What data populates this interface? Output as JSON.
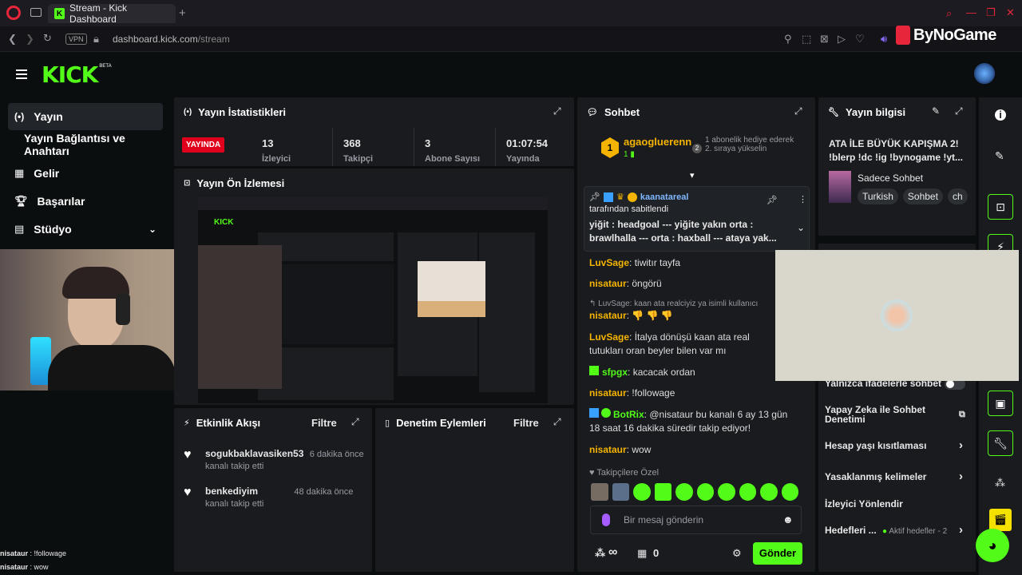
{
  "browser": {
    "tab_title": "Stream - Kick Dashboard",
    "new_tab": "+",
    "url_host": "dashboard.kick.com",
    "url_path": "/stream",
    "vpn_label": "VPN",
    "watermark": "ByNoGame"
  },
  "app": {
    "logo": "KICK",
    "logo_badge": "BETA"
  },
  "sidebar": {
    "items": [
      {
        "label": "Yayın",
        "icon": "broadcast-icon"
      },
      {
        "label": "Yayın Bağlantısı ve Anahtarı"
      },
      {
        "label": "Gelir",
        "icon": "chart-icon"
      },
      {
        "label": "Başarılar",
        "icon": "trophy-icon"
      },
      {
        "label": "Stüdyo",
        "icon": "studio-icon"
      }
    ]
  },
  "stats": {
    "title": "Yayın İstatistikleri",
    "live_badge": "YAYINDA",
    "items": [
      {
        "value": "13",
        "label": "İzleyici"
      },
      {
        "value": "368",
        "label": "Takipçi"
      },
      {
        "value": "3",
        "label": "Abone Sayısı"
      },
      {
        "value": "01:07:54",
        "label": "Yayında"
      }
    ]
  },
  "preview": {
    "title": "Yayın Ön İzlemesi"
  },
  "activity": {
    "title": "Etkinlik Akışı",
    "filter": "Filtre",
    "events": [
      {
        "user": "sogukbaklavasiken53",
        "time": "6 dakika önce",
        "action": "kanalı takip etti"
      },
      {
        "user": "benkediyim",
        "time": "48 dakika önce",
        "action": "kanalı takip etti"
      }
    ]
  },
  "moderation": {
    "title": "Denetim Eylemleri",
    "filter": "Filtre"
  },
  "chat": {
    "title": "Sohbet",
    "gift_user": "agaogluerenn",
    "gift_count": "1",
    "gift_rank": "2",
    "gift_text": "1 abonelik hediye ederek 2. sıraya yükselin",
    "pinned_user": "kaanatareal",
    "pinned_by": "tarafından sabitlendi",
    "pinned_text": "yiğit : headgoal --- yiğite yakın orta : brawlhalla --- orta : haxball --- ataya yak...",
    "messages": [
      {
        "user": "LuvSage",
        "color": "#f5b400",
        "text": "tiwitır tayfa"
      },
      {
        "user": "nisataur",
        "color": "#f5b400",
        "text": "öngörü"
      },
      {
        "reply": "LuvSage: kaan ata realciyiz ya isimli kullanıcı",
        "user": "nisataur",
        "color": "#f5b400",
        "text": "👎 👎 👎"
      },
      {
        "user": "LuvSage",
        "color": "#f5b400",
        "text": "İtalya dönüşü kaan ata real tutukları oran beyler bilen var mı"
      },
      {
        "user": "sfpgx",
        "color": "#53fc18",
        "text": "kacacak ordan"
      },
      {
        "user": "nisataur",
        "color": "#f5b400",
        "text": "!followage"
      },
      {
        "user": "BotRix",
        "color": "#53fc18",
        "text": "@nisataur bu kanalı 6 ay 13 gün 18 saat 16 dakika süredir takip ediyor!"
      },
      {
        "user": "nisataur",
        "color": "#f5b400",
        "text": "wow"
      }
    ],
    "followers_only": "Takipçilere Özel",
    "input_placeholder": "Bir mesaj gönderin",
    "infinity": "∞",
    "points": "0",
    "send": "Gönder"
  },
  "info": {
    "title": "Yayın bilgisi",
    "stream_title": "ATA İLE BÜYÜK KAPIŞMA 2! !blerp !dc !ig !bynogame !yt...",
    "category": "Sadece Sohbet",
    "tags": [
      "Turkish",
      "Sohbet",
      "ch"
    ],
    "settings": [
      {
        "label": "Yalnızca ifadelerle sohbet",
        "type": "toggle"
      },
      {
        "label": "Yapay Zeka ile Sohbet Denetimi",
        "type": "link"
      },
      {
        "label": "Hesap yaşı kısıtlaması",
        "type": "chevron"
      },
      {
        "label": "Yasaklanmış kelimeler",
        "type": "chevron"
      },
      {
        "label": "İzleyici Yönlendir",
        "type": "none"
      },
      {
        "label": "Hedefleri ...",
        "type": "goals",
        "extra": "Aktif hedefler - 2"
      }
    ]
  },
  "overlay_chat": [
    {
      "user": "nisataur",
      "text": "!followage"
    },
    {
      "user": "nisataur",
      "text": "wow"
    }
  ]
}
